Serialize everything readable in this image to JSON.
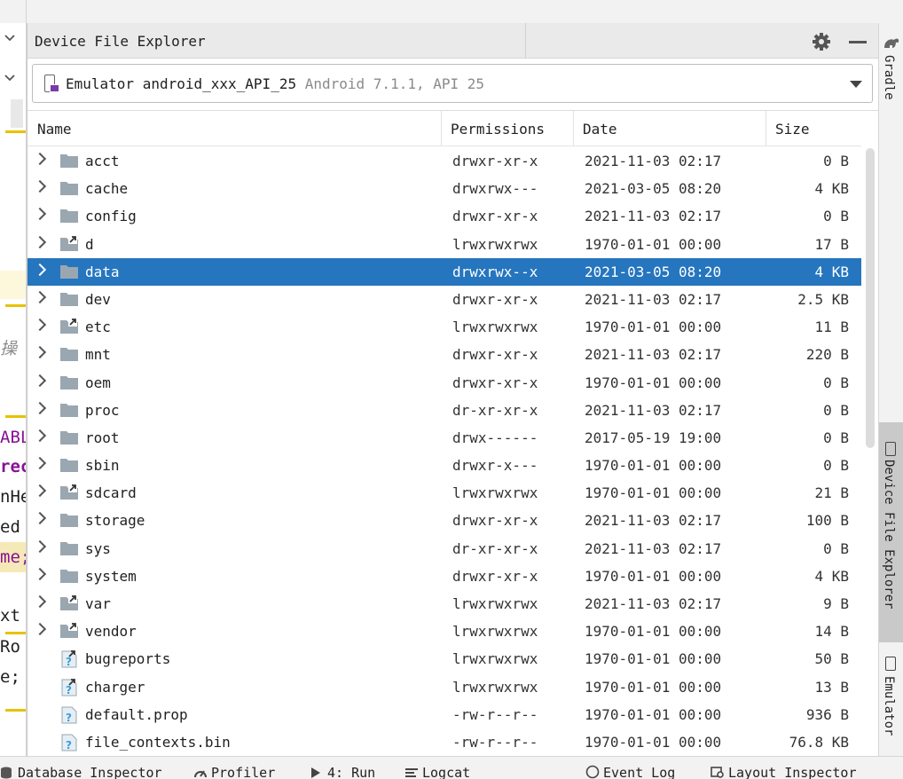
{
  "editor": {
    "fragments": [
      "操",
      "ABL",
      "rec",
      "nHe",
      "ed",
      "me;",
      "xt",
      "Ro",
      "e;"
    ]
  },
  "tool_window": {
    "title": "Device File Explorer",
    "gear_icon": "gear-icon",
    "minimize_icon": "minimize-icon"
  },
  "device": {
    "name": "Emulator android_xxx_API_25",
    "api": "Android 7.1.1, API 25"
  },
  "table": {
    "columns": [
      "Name",
      "Permissions",
      "Date",
      "Size"
    ],
    "rows": [
      {
        "name": "acct",
        "perm": "drwxr-xr-x",
        "date": "2021-11-03 02:17",
        "size": "0 B",
        "type": "folder",
        "expandable": true
      },
      {
        "name": "cache",
        "perm": "drwxrwx---",
        "date": "2021-03-05 08:20",
        "size": "4 KB",
        "type": "folder",
        "expandable": true
      },
      {
        "name": "config",
        "perm": "drwxr-xr-x",
        "date": "2021-11-03 02:17",
        "size": "0 B",
        "type": "folder",
        "expandable": true
      },
      {
        "name": "d",
        "perm": "lrwxrwxrwx",
        "date": "1970-01-01 00:00",
        "size": "17 B",
        "type": "folder-link",
        "expandable": true
      },
      {
        "name": "data",
        "perm": "drwxrwx--x",
        "date": "2021-03-05 08:20",
        "size": "4 KB",
        "type": "folder",
        "expandable": true,
        "selected": true
      },
      {
        "name": "dev",
        "perm": "drwxr-xr-x",
        "date": "2021-11-03 02:17",
        "size": "2.5 KB",
        "type": "folder",
        "expandable": true
      },
      {
        "name": "etc",
        "perm": "lrwxrwxrwx",
        "date": "1970-01-01 00:00",
        "size": "11 B",
        "type": "folder-link",
        "expandable": true
      },
      {
        "name": "mnt",
        "perm": "drwxr-xr-x",
        "date": "2021-11-03 02:17",
        "size": "220 B",
        "type": "folder",
        "expandable": true
      },
      {
        "name": "oem",
        "perm": "drwxr-xr-x",
        "date": "1970-01-01 00:00",
        "size": "0 B",
        "type": "folder",
        "expandable": true
      },
      {
        "name": "proc",
        "perm": "dr-xr-xr-x",
        "date": "2021-11-03 02:17",
        "size": "0 B",
        "type": "folder",
        "expandable": true
      },
      {
        "name": "root",
        "perm": "drwx------",
        "date": "2017-05-19 19:00",
        "size": "0 B",
        "type": "folder",
        "expandable": true
      },
      {
        "name": "sbin",
        "perm": "drwxr-x---",
        "date": "1970-01-01 00:00",
        "size": "0 B",
        "type": "folder",
        "expandable": true
      },
      {
        "name": "sdcard",
        "perm": "lrwxrwxrwx",
        "date": "1970-01-01 00:00",
        "size": "21 B",
        "type": "folder-link",
        "expandable": true
      },
      {
        "name": "storage",
        "perm": "drwxr-xr-x",
        "date": "2021-11-03 02:17",
        "size": "100 B",
        "type": "folder",
        "expandable": true
      },
      {
        "name": "sys",
        "perm": "dr-xr-xr-x",
        "date": "2021-11-03 02:17",
        "size": "0 B",
        "type": "folder",
        "expandable": true
      },
      {
        "name": "system",
        "perm": "drwxr-xr-x",
        "date": "1970-01-01 00:00",
        "size": "4 KB",
        "type": "folder",
        "expandable": true
      },
      {
        "name": "var",
        "perm": "lrwxrwxrwx",
        "date": "2021-11-03 02:17",
        "size": "9 B",
        "type": "folder-link",
        "expandable": true
      },
      {
        "name": "vendor",
        "perm": "lrwxrwxrwx",
        "date": "1970-01-01 00:00",
        "size": "14 B",
        "type": "folder-link",
        "expandable": true
      },
      {
        "name": "bugreports",
        "perm": "lrwxrwxrwx",
        "date": "1970-01-01 00:00",
        "size": "50 B",
        "type": "unknown-link",
        "expandable": false
      },
      {
        "name": "charger",
        "perm": "lrwxrwxrwx",
        "date": "1970-01-01 00:00",
        "size": "13 B",
        "type": "unknown-link",
        "expandable": false
      },
      {
        "name": "default.prop",
        "perm": "-rw-r--r--",
        "date": "1970-01-01 00:00",
        "size": "936 B",
        "type": "unknown-file",
        "expandable": false
      },
      {
        "name": "file_contexts.bin",
        "perm": "-rw-r--r--",
        "date": "1970-01-01 00:00",
        "size": "76.8 KB",
        "type": "unknown-file",
        "expandable": false
      }
    ]
  },
  "right_rail": {
    "gradle": "Gradle",
    "device_file_explorer": "Device File Explorer",
    "emulator": "Emulator"
  },
  "bottom_bar": {
    "database_inspector": "Database Inspector",
    "profiler": "Profiler",
    "run": "4: Run",
    "logcat": "Logcat",
    "event_log": "Event Log",
    "layout_inspector": "Layout Inspector"
  },
  "colors": {
    "selection": "#2675bf",
    "folder": "#9aa7b0",
    "accent_yellow": "#e6c200",
    "help_blue": "#389fd6"
  }
}
